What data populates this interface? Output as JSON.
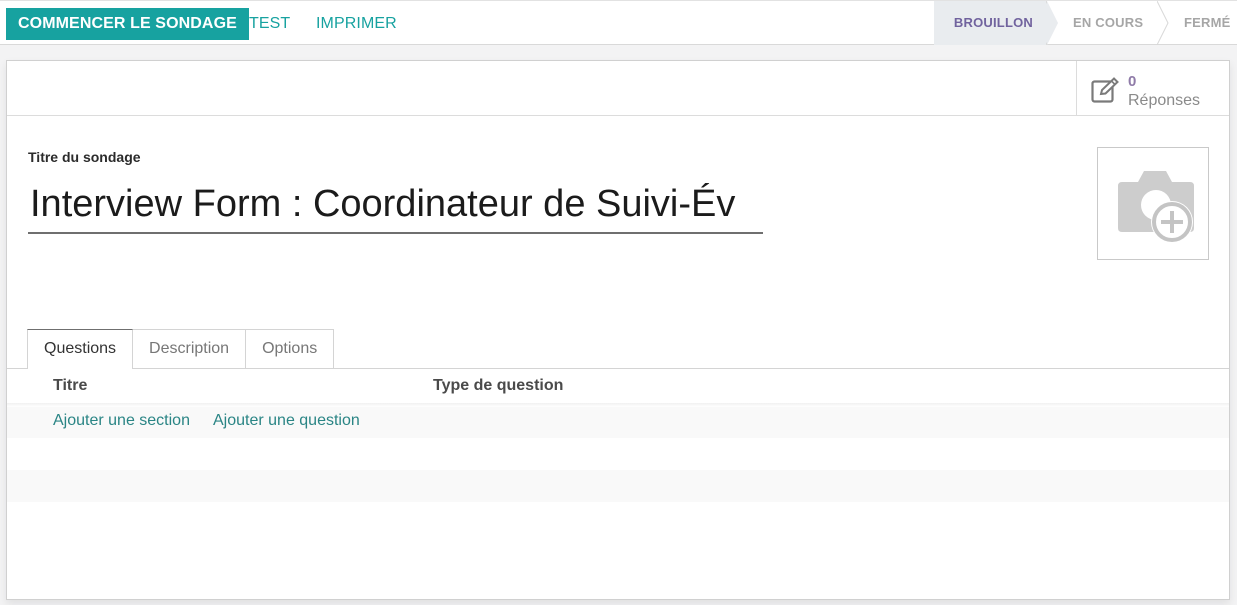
{
  "toolbar": {
    "start_label": "COMMENCER LE SONDAGE",
    "test_label": "TEST",
    "print_label": "IMPRIMER"
  },
  "stages": [
    {
      "label": "BROUILLON",
      "active": true
    },
    {
      "label": "EN COURS",
      "active": false
    },
    {
      "label": "FERMÉ",
      "active": false
    }
  ],
  "stat": {
    "value": "0",
    "label": "Réponses",
    "icon": "edit-icon"
  },
  "form": {
    "title_label": "Titre du sondage",
    "title_value": "Interview Form : Coordinateur de Suivi-Év",
    "image_icon": "camera-plus-icon"
  },
  "tabs": [
    {
      "label": "Questions",
      "active": true
    },
    {
      "label": "Description",
      "active": false
    },
    {
      "label": "Options",
      "active": false
    }
  ],
  "table": {
    "columns": [
      "Titre",
      "Type de question"
    ],
    "add_section": "Ajouter une section",
    "add_question": "Ajouter une question"
  },
  "colors": {
    "primary": "#17a2a0",
    "stage_active": "#71639e",
    "stat_value": "#8f7ba8"
  }
}
